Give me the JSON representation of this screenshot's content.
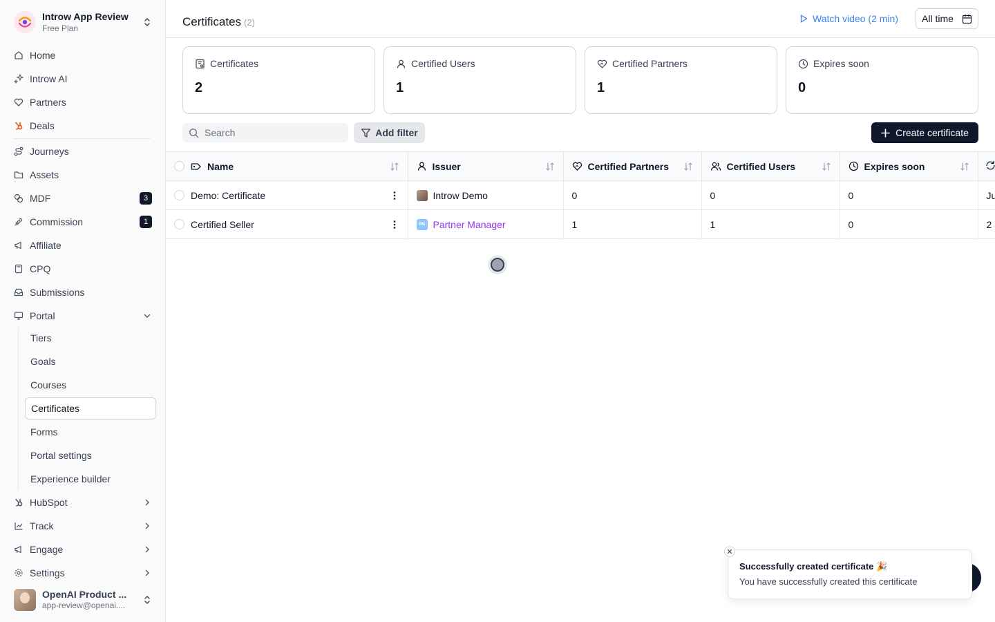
{
  "workspace": {
    "name": "Introw App Review",
    "plan": "Free Plan"
  },
  "sidebar": {
    "items": [
      {
        "label": "Home",
        "icon": "home-icon"
      },
      {
        "label": "Introw AI",
        "icon": "sparkle-icon"
      },
      {
        "label": "Partners",
        "icon": "handshake-heart-icon"
      },
      {
        "label": "Deals",
        "icon": "hubspot-icon"
      },
      {
        "label": "Journeys",
        "icon": "route-icon"
      },
      {
        "label": "Assets",
        "icon": "folder-icon"
      },
      {
        "label": "MDF",
        "icon": "coins-icon",
        "badge": "3"
      },
      {
        "label": "Commission",
        "icon": "handcoins-icon",
        "badge": "1"
      },
      {
        "label": "Affiliate",
        "icon": "megaphone-icon"
      },
      {
        "label": "CPQ",
        "icon": "calculator-icon"
      },
      {
        "label": "Submissions",
        "icon": "inbox-icon"
      },
      {
        "label": "Portal",
        "icon": "monitor-icon"
      }
    ],
    "portal_sub": [
      "Tiers",
      "Goals",
      "Courses",
      "Certificates",
      "Forms",
      "Portal settings",
      "Experience builder"
    ],
    "groups": [
      {
        "label": "HubSpot",
        "icon": "hubspot-icon"
      },
      {
        "label": "Track",
        "icon": "chart-line-icon"
      },
      {
        "label": "Engage",
        "icon": "megaphone-icon"
      },
      {
        "label": "Settings",
        "icon": "gear-icon"
      }
    ],
    "user": {
      "name": "OpenAI Product ...",
      "email": "app-review@openai...."
    }
  },
  "header": {
    "title": "Certificates",
    "count": "(2)",
    "watch_video": "Watch video (2 min)",
    "date_range": "All time"
  },
  "stats": [
    {
      "label": "Certificates",
      "value": "2",
      "icon": "certificate-icon"
    },
    {
      "label": "Certified Users",
      "value": "1",
      "icon": "user-icon"
    },
    {
      "label": "Certified Partners",
      "value": "1",
      "icon": "handshake-heart-icon"
    },
    {
      "label": "Expires soon",
      "value": "0",
      "icon": "clock-icon"
    }
  ],
  "toolbar": {
    "search_placeholder": "Search",
    "add_filter": "Add filter",
    "create": "Create certificate"
  },
  "table": {
    "columns": [
      "Name",
      "Issuer",
      "Certified Partners",
      "Certified Users",
      "Expires soon"
    ],
    "rows": [
      {
        "name": "Demo: Certificate",
        "issuer": "Introw Demo",
        "partners": "0",
        "users": "0",
        "expires": "0",
        "extra": "Ju"
      },
      {
        "name": "Certified Seller",
        "issuer": "Partner Manager",
        "issuer_initials": "PM",
        "partners": "1",
        "users": "1",
        "expires": "0",
        "extra": "2"
      }
    ]
  },
  "toast": {
    "title": "Successfully created certificate 🎉",
    "description": "You have successfully created this certificate"
  }
}
